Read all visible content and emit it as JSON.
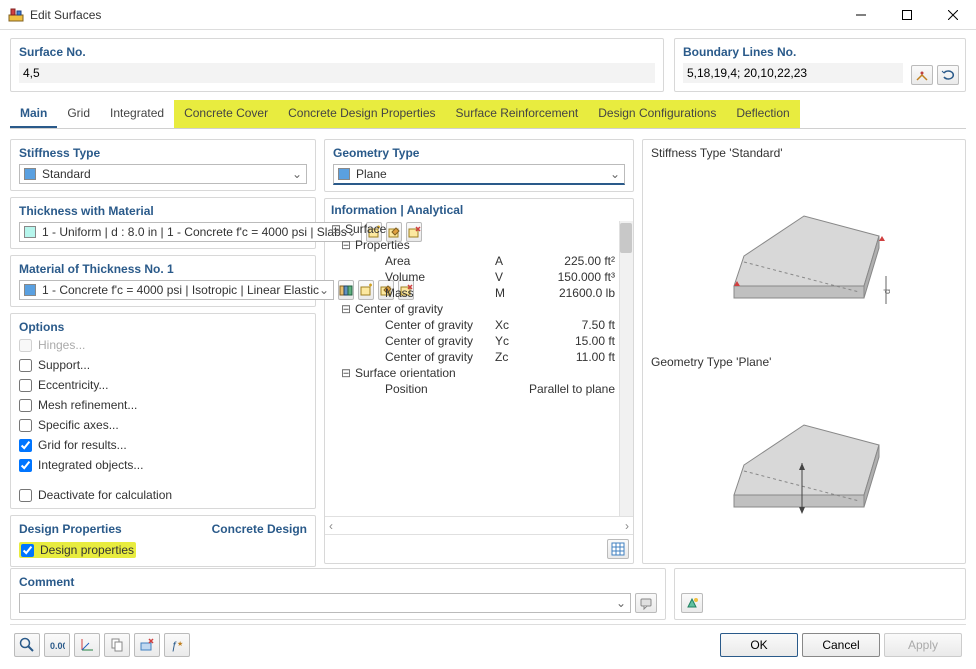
{
  "window": {
    "title": "Edit Surfaces"
  },
  "surface_no": {
    "label": "Surface No.",
    "value": "4,5"
  },
  "boundary": {
    "label": "Boundary Lines No.",
    "value": "5,18,19,4; 20,10,22,23"
  },
  "tabs": [
    {
      "label": "Main",
      "active": true,
      "hl": false
    },
    {
      "label": "Grid",
      "active": false,
      "hl": false
    },
    {
      "label": "Integrated",
      "active": false,
      "hl": false
    },
    {
      "label": "Concrete Cover",
      "active": false,
      "hl": true
    },
    {
      "label": "Concrete Design Properties",
      "active": false,
      "hl": true
    },
    {
      "label": "Surface Reinforcement",
      "active": false,
      "hl": true
    },
    {
      "label": "Design Configurations",
      "active": false,
      "hl": true
    },
    {
      "label": "Deflection",
      "active": false,
      "hl": true
    }
  ],
  "stiffness": {
    "label": "Stiffness Type",
    "value": "Standard",
    "swatch": "#5aa0e0"
  },
  "geometry": {
    "label": "Geometry Type",
    "value": "Plane",
    "swatch": "#5aa0e0"
  },
  "thickness": {
    "label": "Thickness with Material",
    "value": "1 - Uniform | d : 8.0 in | 1 - Concrete f'c = 4000 psi | Slabs",
    "swatch": "#b6f5ec"
  },
  "material": {
    "label": "Material of Thickness No. 1",
    "value": "1 - Concrete f'c = 4000 psi | Isotropic | Linear Elastic",
    "swatch": "#5aa0e0"
  },
  "options": {
    "label": "Options",
    "items": [
      {
        "label": "Hinges...",
        "checked": false,
        "disabled": true
      },
      {
        "label": "Support...",
        "checked": false
      },
      {
        "label": "Eccentricity...",
        "checked": false
      },
      {
        "label": "Mesh refinement...",
        "checked": false
      },
      {
        "label": "Specific axes...",
        "checked": false
      },
      {
        "label": "Grid for results...",
        "checked": true
      },
      {
        "label": "Integrated objects...",
        "checked": true
      },
      {
        "label": "Deactivate for calculation",
        "checked": false,
        "gap": true
      }
    ]
  },
  "design": {
    "label1": "Design Properties",
    "label2": "Concrete Design",
    "check": "Design properties"
  },
  "info": {
    "label": "Information | Analytical",
    "groups": [
      {
        "title": "Surface",
        "children": [
          {
            "title": "Properties",
            "rows": [
              {
                "k": "Area",
                "sym": "A",
                "v": "225.00 ft²"
              },
              {
                "k": "Volume",
                "sym": "V",
                "v": "150.000 ft³"
              },
              {
                "k": "Mass",
                "sym": "M",
                "v": "21600.0 lb"
              }
            ]
          },
          {
            "title": "Center of gravity",
            "rows": [
              {
                "k": "Center of gravity",
                "sym": "Xc",
                "v": "7.50 ft"
              },
              {
                "k": "Center of gravity",
                "sym": "Yc",
                "v": "15.00 ft"
              },
              {
                "k": "Center of gravity",
                "sym": "Zc",
                "v": "11.00 ft"
              }
            ]
          },
          {
            "title": "Surface orientation",
            "rows": [
              {
                "k": "Position",
                "sym": "",
                "v": "Parallel to plane"
              }
            ]
          }
        ]
      }
    ]
  },
  "preview": {
    "label1": "Stiffness Type 'Standard'",
    "label2": "Geometry Type 'Plane'"
  },
  "comment": {
    "label": "Comment",
    "value": ""
  },
  "buttons": {
    "ok": "OK",
    "cancel": "Cancel",
    "apply": "Apply"
  },
  "colors": {
    "accent": "#2a5a8a",
    "highlight": "#e8ec3f"
  }
}
